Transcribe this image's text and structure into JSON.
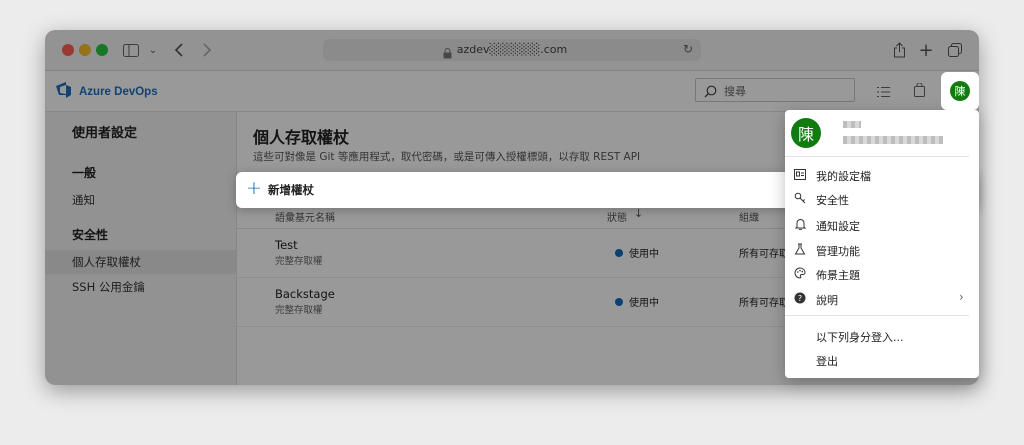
{
  "browser": {
    "url": "azdev░░░░░░.com",
    "traffic_lights": [
      "#ff5f57",
      "#febc2e",
      "#28c840"
    ]
  },
  "header": {
    "brand": "Azure DevOps",
    "search_placeholder": "搜尋",
    "avatar_initial": "陳",
    "avatar_color": "#107c10"
  },
  "sidebar": {
    "title": "使用者設定",
    "sections": [
      {
        "heading": "一般",
        "items": [
          "通知"
        ]
      },
      {
        "heading": "安全性",
        "items": [
          "個人存取權杖",
          "SSH 公用金鑰"
        ]
      }
    ],
    "selected": "個人存取權杖"
  },
  "main": {
    "title": "個人存取權杖",
    "subtitle": "這些可對像是 Git 等應用程式，取代密碼，或是可傳入授權標頭，以存取 REST API",
    "new_token_label": "新增權杖",
    "columns": [
      "語彙基元名稱",
      "狀態",
      "組織"
    ],
    "tokens": [
      {
        "name": "Test",
        "scope": "完整存取權",
        "status": "使用中",
        "org": "所有可存取"
      },
      {
        "name": "Backstage",
        "scope": "完整存取權",
        "status": "使用中",
        "org": "所有可存取"
      }
    ],
    "accent": "#0f6cbd"
  },
  "user_menu": {
    "items": [
      {
        "label": "我的設定檔",
        "icon": "profile-card-icon"
      },
      {
        "label": "安全性",
        "icon": "key-icon"
      },
      {
        "label": "通知設定",
        "icon": "bell-icon"
      },
      {
        "label": "管理功能",
        "icon": "feature-flask-icon"
      },
      {
        "label": "佈景主題",
        "icon": "palette-icon"
      },
      {
        "label": "說明",
        "icon": "help-icon"
      }
    ],
    "sign_in_other": "以下列身分登入...",
    "sign_out": "登出"
  }
}
